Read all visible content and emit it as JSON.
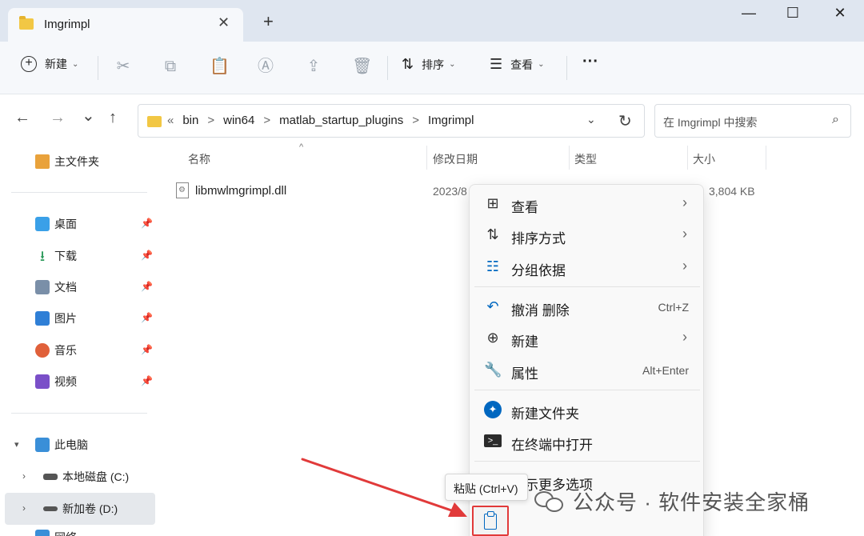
{
  "tab": {
    "title": "Imgrimpl",
    "close": "✕",
    "new": "+"
  },
  "window": {
    "minimize": "—",
    "maximize": "☐",
    "close": "✕"
  },
  "toolbar": {
    "new_label": "新建",
    "sort_label": "排序",
    "view_label": "查看",
    "more": "···"
  },
  "nav": {
    "back": "←",
    "forward": "→",
    "recent": "⌄",
    "up": "↑",
    "breadcrumb": [
      "«",
      "bin",
      ">",
      "win64",
      ">",
      "matlab_startup_plugins",
      ">",
      "Imgrimpl"
    ],
    "search_placeholder": "在 Imgrimpl 中搜索"
  },
  "sidebar": {
    "home": "主文件夹",
    "quick": [
      {
        "label": "桌面",
        "color": "#3aa0e8"
      },
      {
        "label": "下载",
        "color": "#2b9a5a"
      },
      {
        "label": "文档",
        "color": "#7a8fa8"
      },
      {
        "label": "图片",
        "color": "#2f7fd6"
      },
      {
        "label": "音乐",
        "color": "#e0603a"
      },
      {
        "label": "视频",
        "color": "#7a4fc8"
      }
    ],
    "this_pc": "此电脑",
    "drives": [
      "本地磁盘 (C:)",
      "新加卷 (D:)"
    ],
    "network": "网络"
  },
  "columns": {
    "name": "名称",
    "date": "修改日期",
    "type": "类型",
    "size": "大小"
  },
  "files": [
    {
      "name": "libmwlmgrimpl.dll",
      "date": "2023/8",
      "size": "3,804 KB"
    }
  ],
  "context_menu": [
    {
      "label": "查看",
      "icon": "grid-icon",
      "arrow": "›"
    },
    {
      "label": "排序方式",
      "icon": "sort-icon",
      "arrow": "›"
    },
    {
      "label": "分组依据",
      "icon": "group-icon",
      "arrow": "›"
    },
    {
      "label": "撤消 删除",
      "icon": "undo-icon",
      "shortcut": "Ctrl+Z"
    },
    {
      "label": "新建",
      "icon": "add-icon",
      "arrow": "›"
    },
    {
      "label": "属性",
      "icon": "wrench-icon",
      "shortcut": "Alt+Enter"
    },
    {
      "label": "新建文件夹",
      "icon": "new-folder-icon"
    },
    {
      "label": "在终端中打开",
      "icon": "terminal-icon"
    },
    {
      "label": "显示更多选项",
      "icon": "more-options-icon"
    }
  ],
  "tooltip": "粘贴 (Ctrl+V)",
  "watermark": "公众号 · 软件安装全家桶",
  "colors": {
    "accent": "#0067c0",
    "highlight": "#e13a3a"
  }
}
